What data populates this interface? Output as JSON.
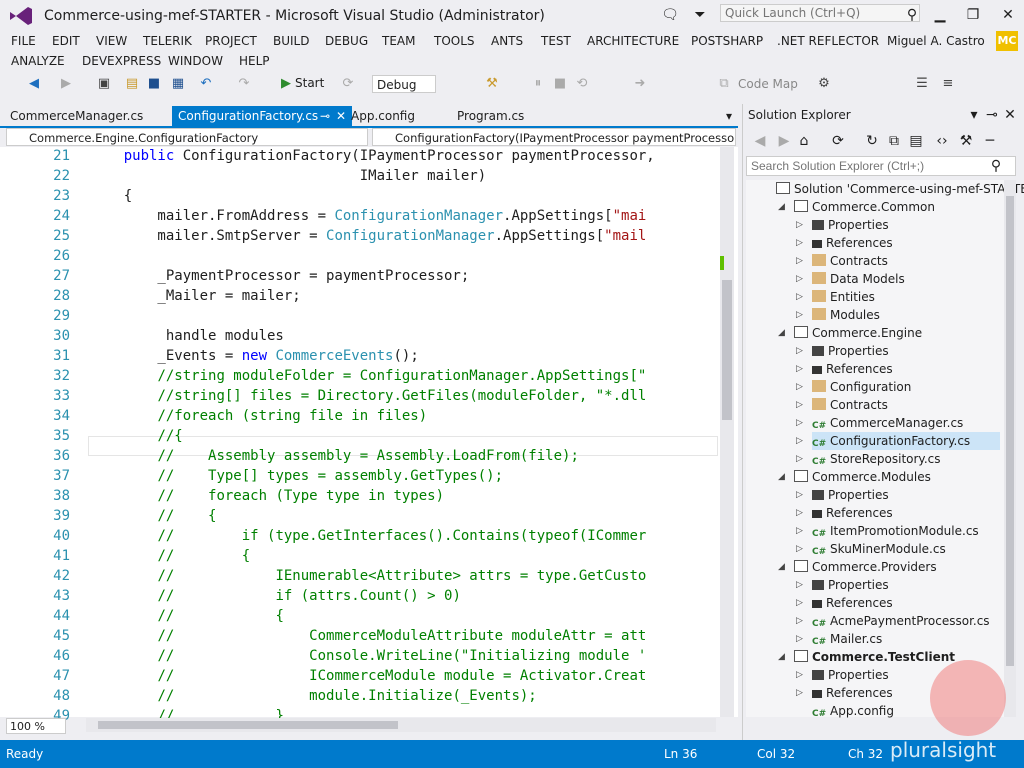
{
  "title": "Commerce-using-mef-STARTER - Microsoft Visual Studio (Administrator)",
  "quick_launch_placeholder": "Quick Launch (Ctrl+Q)",
  "menu": [
    "FILE",
    "EDIT",
    "VIEW",
    "TELERIK",
    "PROJECT",
    "BUILD",
    "DEBUG",
    "TEAM",
    "TOOLS",
    "ANTS",
    "TEST",
    "ARCHITECTURE",
    "POSTSHARP",
    ".NET REFLECTOR",
    "ANALYZE",
    "DEVEXPRESS",
    "WINDOW",
    "HELP"
  ],
  "user": "Miguel A. Castro",
  "user_initials": "MC",
  "toolbar": {
    "start_label": "Start",
    "config": "Debug",
    "codemap": "Code Map"
  },
  "tabs": [
    "CommerceManager.cs",
    "ConfigurationFactory.cs",
    "App.config",
    "Program.cs"
  ],
  "nav": {
    "left": "Commerce.Engine.ConfigurationFactory",
    "right": "ConfigurationFactory(IPaymentProcessor paymentProcessor, I"
  },
  "code_lines": [
    {
      "n": "21",
      "t": "    public ConfigurationFactory(IPaymentProcessor paymentProcessor,"
    },
    {
      "n": "22",
      "t": "                                IMailer mailer)"
    },
    {
      "n": "23",
      "t": "    {"
    },
    {
      "n": "24",
      "t": "        mailer.FromAddress = ConfigurationManager.AppSettings[\"mai"
    },
    {
      "n": "25",
      "t": "        mailer.SmtpServer = ConfigurationManager.AppSettings[\"mail"
    },
    {
      "n": "26",
      "t": ""
    },
    {
      "n": "27",
      "t": "        _PaymentProcessor = paymentProcessor;"
    },
    {
      "n": "28",
      "t": "        _Mailer = mailer;"
    },
    {
      "n": "29",
      "t": ""
    },
    {
      "n": "30",
      "t": "         handle modules"
    },
    {
      "n": "31",
      "t": "        _Events = new CommerceEvents();"
    },
    {
      "n": "32",
      "t": "        //string moduleFolder = ConfigurationManager.AppSettings[\""
    },
    {
      "n": "33",
      "t": "        //string[] files = Directory.GetFiles(moduleFolder, \"*.dll"
    },
    {
      "n": "34",
      "t": "        //foreach (string file in files)"
    },
    {
      "n": "35",
      "t": "        //{"
    },
    {
      "n": "36",
      "t": "        //    Assembly assembly = Assembly.LoadFrom(file);"
    },
    {
      "n": "37",
      "t": "        //    Type[] types = assembly.GetTypes();"
    },
    {
      "n": "38",
      "t": "        //    foreach (Type type in types)"
    },
    {
      "n": "39",
      "t": "        //    {"
    },
    {
      "n": "40",
      "t": "        //        if (type.GetInterfaces().Contains(typeof(ICommer"
    },
    {
      "n": "41",
      "t": "        //        {"
    },
    {
      "n": "42",
      "t": "        //            IEnumerable<Attribute> attrs = type.GetCusto"
    },
    {
      "n": "43",
      "t": "        //            if (attrs.Count() > 0)"
    },
    {
      "n": "44",
      "t": "        //            {"
    },
    {
      "n": "45",
      "t": "        //                CommerceModuleAttribute moduleAttr = att"
    },
    {
      "n": "46",
      "t": "        //                Console.WriteLine(\"Initializing module '"
    },
    {
      "n": "47",
      "t": "        //                ICommerceModule module = Activator.Creat"
    },
    {
      "n": "48",
      "t": "        //                module.Initialize(_Events);"
    },
    {
      "n": "49",
      "t": "        //            }"
    }
  ],
  "zoom": "100 %",
  "solution_explorer": {
    "title": "Solution Explorer",
    "search_placeholder": "Search Solution Explorer (Ctrl+;)",
    "nodes": [
      {
        "label": "Solution 'Commerce-using-mef-STARTER",
        "level": 0,
        "icon": "proj",
        "arrow": ""
      },
      {
        "label": "Commerce.Common",
        "level": 1,
        "icon": "proj",
        "arrow": "down"
      },
      {
        "label": "Properties",
        "level": 2,
        "icon": "prop",
        "arrow": "right"
      },
      {
        "label": "References",
        "level": 2,
        "icon": "ref",
        "arrow": "right"
      },
      {
        "label": "Contracts",
        "level": 2,
        "icon": "folder",
        "arrow": "right"
      },
      {
        "label": "Data Models",
        "level": 2,
        "icon": "folder",
        "arrow": "right"
      },
      {
        "label": "Entities",
        "level": 2,
        "icon": "folder",
        "arrow": "right"
      },
      {
        "label": "Modules",
        "level": 2,
        "icon": "folder",
        "arrow": "right"
      },
      {
        "label": "Commerce.Engine",
        "level": 1,
        "icon": "proj",
        "arrow": "down"
      },
      {
        "label": "Properties",
        "level": 2,
        "icon": "prop",
        "arrow": "right"
      },
      {
        "label": "References",
        "level": 2,
        "icon": "ref",
        "arrow": "right"
      },
      {
        "label": "Configuration",
        "level": 2,
        "icon": "folder",
        "arrow": "right"
      },
      {
        "label": "Contracts",
        "level": 2,
        "icon": "folder",
        "arrow": "right"
      },
      {
        "label": "CommerceManager.cs",
        "level": 2,
        "icon": "cs",
        "arrow": "right"
      },
      {
        "label": "ConfigurationFactory.cs",
        "level": 2,
        "icon": "cs",
        "arrow": "right",
        "selected": true
      },
      {
        "label": "StoreRepository.cs",
        "level": 2,
        "icon": "cs",
        "arrow": "right"
      },
      {
        "label": "Commerce.Modules",
        "level": 1,
        "icon": "proj",
        "arrow": "down"
      },
      {
        "label": "Properties",
        "level": 2,
        "icon": "prop",
        "arrow": "right"
      },
      {
        "label": "References",
        "level": 2,
        "icon": "ref",
        "arrow": "right"
      },
      {
        "label": "ItemPromotionModule.cs",
        "level": 2,
        "icon": "cs",
        "arrow": "right"
      },
      {
        "label": "SkuMinerModule.cs",
        "level": 2,
        "icon": "cs",
        "arrow": "right"
      },
      {
        "label": "Commerce.Providers",
        "level": 1,
        "icon": "proj",
        "arrow": "down"
      },
      {
        "label": "Properties",
        "level": 2,
        "icon": "prop",
        "arrow": "right"
      },
      {
        "label": "References",
        "level": 2,
        "icon": "ref",
        "arrow": "right"
      },
      {
        "label": "AcmePaymentProcessor.cs",
        "level": 2,
        "icon": "cs",
        "arrow": "right"
      },
      {
        "label": "Mailer.cs",
        "level": 2,
        "icon": "cs",
        "arrow": "right"
      },
      {
        "label": "Commerce.TestClient",
        "level": 1,
        "icon": "proj",
        "arrow": "down",
        "bold": true
      },
      {
        "label": "Properties",
        "level": 2,
        "icon": "prop",
        "arrow": "right"
      },
      {
        "label": "References",
        "level": 2,
        "icon": "ref",
        "arrow": "right"
      },
      {
        "label": "App.config",
        "level": 2,
        "icon": "cs",
        "arrow": ""
      }
    ]
  },
  "status": {
    "ready": "Ready",
    "ln": "Ln 36",
    "col": "Col 32",
    "ch": "Ch 32"
  },
  "watermark": "pluralsight",
  "colors": {
    "accent": "#007acc",
    "keyword": "#0000ff",
    "type": "#2b91af",
    "comment": "#008000",
    "string": "#a31515"
  }
}
